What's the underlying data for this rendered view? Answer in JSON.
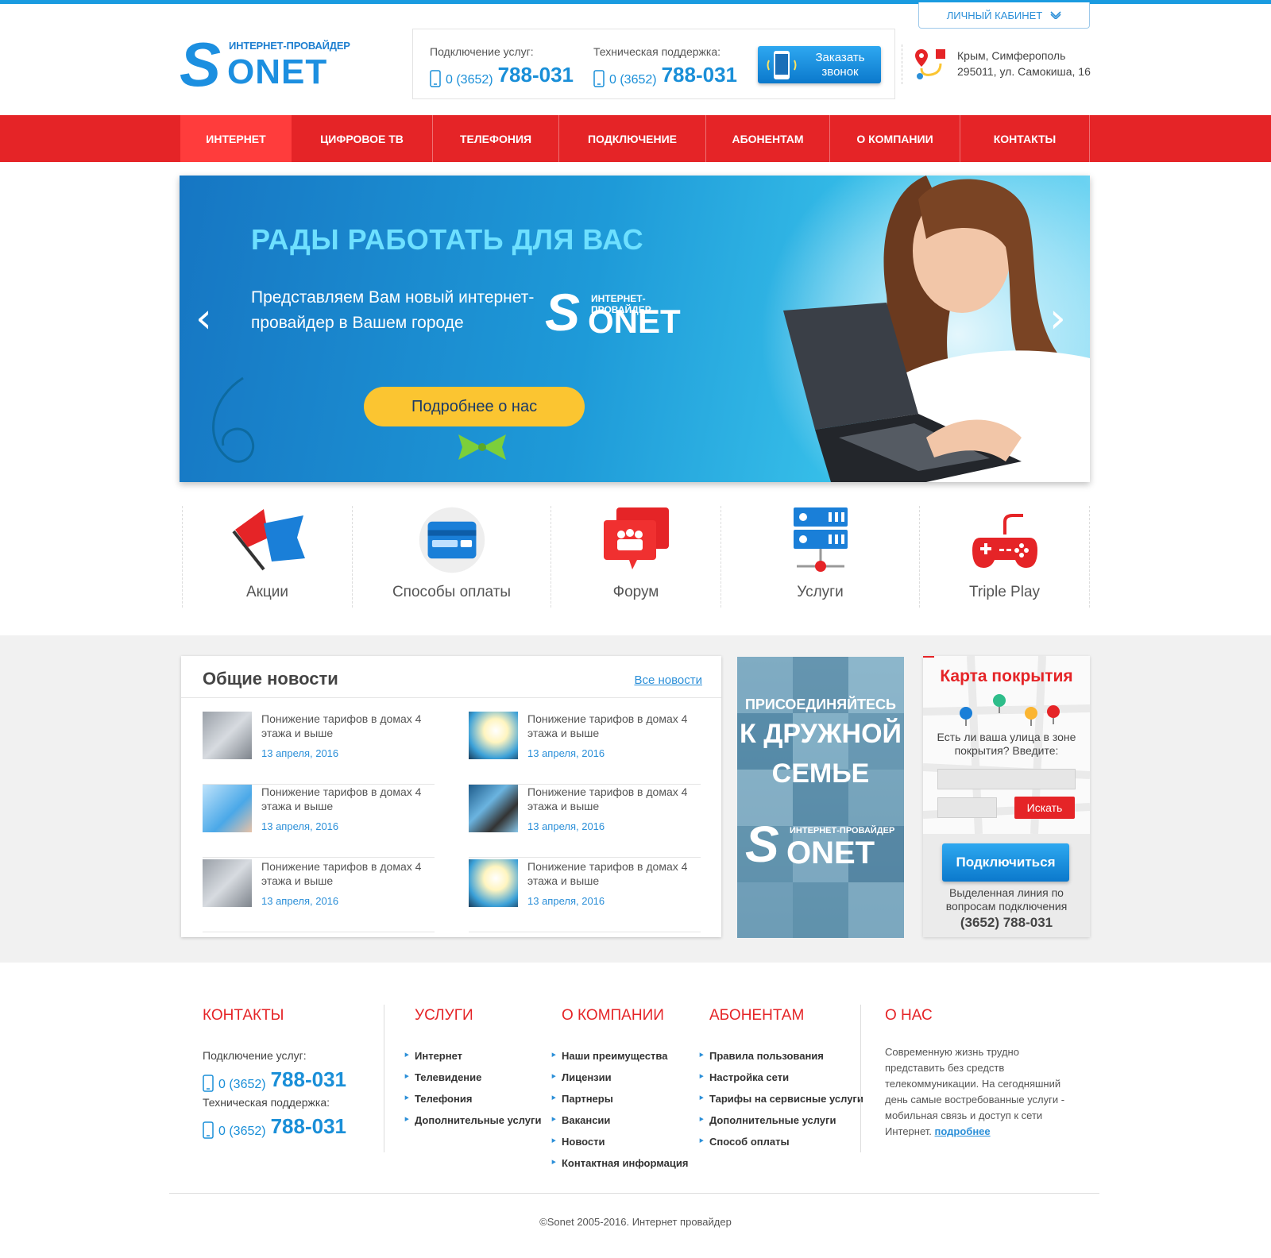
{
  "header": {
    "cabinet_label": "Личный кабинет",
    "logo_subtitle": "ИНТЕРНЕТ-ПРОВАЙДЕР",
    "logo_text": "ONET",
    "logo_letter": "S",
    "connection_label": "Подключение услуг:",
    "support_label": "Техническая поддержка:",
    "phone_code": "0 (3652)",
    "phone_number": "788-031",
    "call_button_line1": "Заказать",
    "call_button_line2": "звонок",
    "address_line1": "Крым, Симферополь",
    "address_line2": "295011, ул. Самокиша, 16"
  },
  "nav": {
    "items": [
      {
        "label": "Интернет"
      },
      {
        "label": "Цифровое ТВ"
      },
      {
        "label": "Телефония"
      },
      {
        "label": "Подключение"
      },
      {
        "label": "Абонентам"
      },
      {
        "label": "О компании"
      },
      {
        "label": "Контакты"
      }
    ]
  },
  "banner": {
    "title": "Рады работать для вас",
    "text": "Представляем Вам новый интернет-провайдер в Вашем городе",
    "button": "Подробнее о нас",
    "logo_subtitle": "ИНТЕРНЕТ-ПРОВАЙДЕР",
    "logo_text": "ONET",
    "logo_letter": "S",
    "prev_arrow": "‹",
    "next_arrow": "›"
  },
  "features": {
    "items": [
      {
        "label": "Акции"
      },
      {
        "label": "Способы оплаты"
      },
      {
        "label": "Форум"
      },
      {
        "label": "Услуги"
      },
      {
        "label": "Triple Play"
      }
    ]
  },
  "news": {
    "title": "Общие новости",
    "all_link": "Все новости",
    "items": [
      {
        "text": "Понижение тарифов в домах 4 этажа и выше",
        "date": "13 апреля, 2016"
      },
      {
        "text": "Понижение тарифов в домах 4 этажа и выше",
        "date": "13 апреля, 2016"
      },
      {
        "text": "Понижение тарифов в домах 4 этажа и выше",
        "date": "13 апреля, 2016"
      },
      {
        "text": "Понижение тарифов в домах 4 этажа и выше",
        "date": "13 апреля, 2016"
      },
      {
        "text": "Понижение тарифов в домах 4 этажа и выше",
        "date": "13 апреля, 2016"
      },
      {
        "text": "Понижение тарифов в домах 4 этажа и выше",
        "date": "13 апреля, 2016"
      }
    ]
  },
  "join": {
    "line1": "Присоединяйтесь",
    "line2": "к дружной",
    "line3": "семье",
    "logo_subtitle": "ИНТЕРНЕТ-ПРОВАЙДЕР",
    "logo_text": "ONET",
    "logo_letter": "S"
  },
  "coverage": {
    "title": "Карта покрытия",
    "question": "Есть ли ваша улица в зоне покрытия? Введите:",
    "search_button": "Искать",
    "connect_button": "Подключиться",
    "line_text": "Выделенная линия по вопросам подключения",
    "phone": "(3652) 788-031"
  },
  "footer": {
    "contacts": {
      "title": "Контакты",
      "connection_label": "Подключение услуг:",
      "support_label": "Техническая поддержка:",
      "phone_code": "0 (3652)",
      "phone_number": "788-031"
    },
    "services": {
      "title": "Услуги",
      "items": [
        "Интернет",
        "Телевидение",
        "Телефония",
        "Дополнительные услуги"
      ]
    },
    "company": {
      "title": "О компании",
      "items": [
        "Наши преимущества",
        "Лицензии",
        "Партнеры",
        "Вакансии",
        "Новости",
        "Контактная информация"
      ]
    },
    "subscribers": {
      "title": "Абонентам",
      "items": [
        "Правила пользования",
        "Настройка сети",
        "Тарифы на сервисные услуги",
        "Дополнительные услуги",
        "Способ оплаты"
      ]
    },
    "about": {
      "title": "О нас",
      "text": "Современную жизнь трудно представить без средств телекоммуникации. На сегодняшний день самые востребованные услуги - мобильная связь и доступ к сети Интернет.",
      "link": "подробнее"
    },
    "copyright": "©Sonet 2005-2016. Интернет провайдер"
  },
  "colors": {
    "brand_blue": "#1a8fd8",
    "brand_red": "#e52427",
    "accent_yellow": "#fbc531"
  }
}
